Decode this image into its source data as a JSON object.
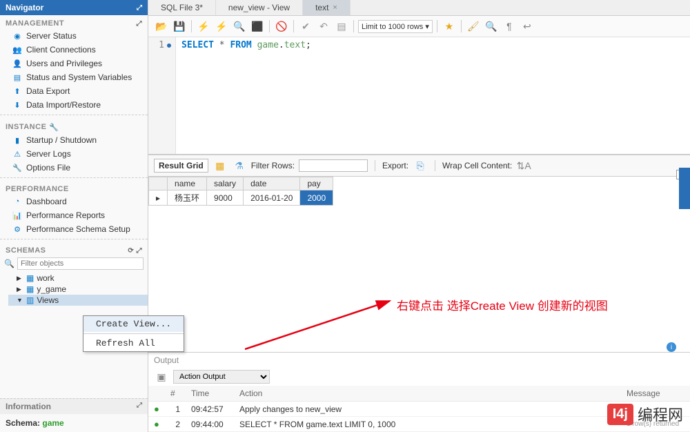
{
  "navigator": {
    "title": "Navigator",
    "management": {
      "title": "MANAGEMENT",
      "items": [
        "Server Status",
        "Client Connections",
        "Users and Privileges",
        "Status and System Variables",
        "Data Export",
        "Data Import/Restore"
      ]
    },
    "instance": {
      "title": "INSTANCE",
      "items": [
        "Startup / Shutdown",
        "Server Logs",
        "Options File"
      ]
    },
    "performance": {
      "title": "PERFORMANCE",
      "items": [
        "Dashboard",
        "Performance Reports",
        "Performance Schema Setup"
      ]
    },
    "schemas": {
      "title": "SCHEMAS",
      "filter_placeholder": "Filter objects",
      "tree": [
        {
          "label": "work",
          "expanded": false
        },
        {
          "label": "y_game",
          "expanded": false
        },
        {
          "label": "Views",
          "expanded": true,
          "selected": true
        }
      ]
    },
    "information": {
      "title": "Information",
      "schema_label": "Schema:",
      "schema_value": "game"
    }
  },
  "tabs": [
    {
      "label": "SQL File 3*",
      "active": false
    },
    {
      "label": "new_view - View",
      "active": false
    },
    {
      "label": "text",
      "active": true
    }
  ],
  "toolbar": {
    "limit_label": "Limit to 1000 rows"
  },
  "editor": {
    "line": 1,
    "sql_tokens": [
      "SELECT",
      "*",
      "FROM",
      "game",
      ".",
      "text",
      ";"
    ]
  },
  "result": {
    "grid_label": "Result Grid",
    "filter_label": "Filter Rows:",
    "export_label": "Export:",
    "wrap_label": "Wrap Cell Content:",
    "columns": [
      "name",
      "salary",
      "date",
      "pay"
    ],
    "rows": [
      {
        "name": "杨玉环",
        "salary": "9000",
        "date": "2016-01-20",
        "pay": "2000",
        "selected_col": "pay"
      }
    ]
  },
  "annotation": {
    "text": "右键点击 选择Create View 创建新的视图"
  },
  "context_menu": {
    "items": [
      "Create View...",
      "Refresh All"
    ]
  },
  "output": {
    "title": "Output",
    "combo": "Action Output",
    "columns": [
      "",
      "#",
      "Time",
      "Action",
      "Message"
    ],
    "rows": [
      {
        "status": "ok",
        "num": "1",
        "time": "09:42:57",
        "action": "Apply changes to new_view",
        "message": ""
      },
      {
        "status": "ok",
        "num": "2",
        "time": "09:44:00",
        "action": "SELECT * FROM game.text LIMIT 0, 1000",
        "message": "1 row(s) returned"
      }
    ]
  },
  "watermark": {
    "badge": "I4j",
    "text": "编程网"
  }
}
